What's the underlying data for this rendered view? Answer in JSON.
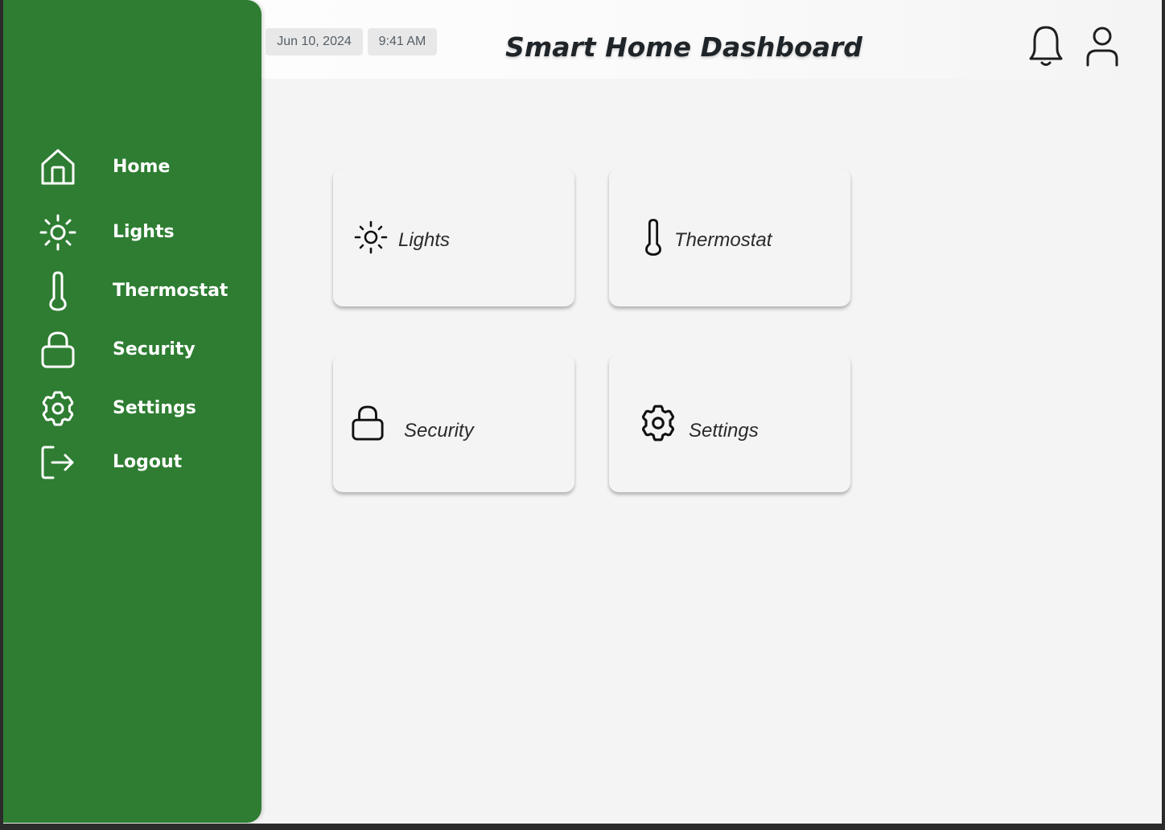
{
  "header": {
    "date": "Jun 10, 2024",
    "time": "9:41 AM",
    "title": "Smart Home Dashboard",
    "icons": [
      "bell-icon",
      "user-icon"
    ]
  },
  "sidebar": {
    "items": [
      {
        "label": "Home",
        "icon": "home-icon"
      },
      {
        "label": "Lights",
        "icon": "sun-icon"
      },
      {
        "label": "Thermostat",
        "icon": "thermometer-icon"
      },
      {
        "label": "Security",
        "icon": "lock-icon"
      },
      {
        "label": "Settings",
        "icon": "gear-icon"
      },
      {
        "label": "Logout",
        "icon": "logout-icon"
      }
    ]
  },
  "cards": [
    {
      "label": "Lights",
      "icon": "sun-icon"
    },
    {
      "label": "Thermostat",
      "icon": "thermometer-icon"
    },
    {
      "label": "Security",
      "icon": "lock-icon"
    },
    {
      "label": "Settings",
      "icon": "gear-icon"
    }
  ],
  "colors": {
    "sidebar": "#2e7d32",
    "background": "#f4f4f4",
    "title_text": "#1f2428"
  }
}
